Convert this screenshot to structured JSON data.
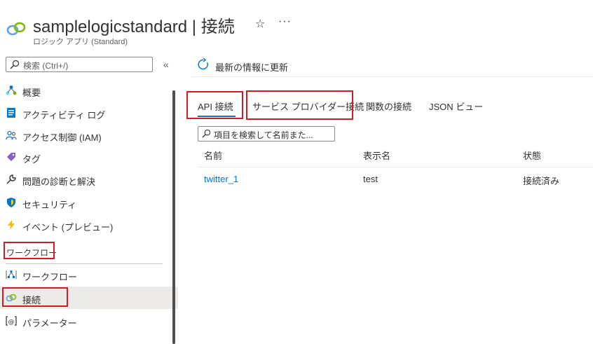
{
  "header": {
    "title": "samplelogicstandard | 接続",
    "subtitle": "ロジック アプリ (Standard)",
    "favorite_icon": "star-icon",
    "more_label": "···"
  },
  "search": {
    "placeholder": "検索 (Ctrl+/)",
    "collapse_label": "«"
  },
  "sidebar": {
    "items": [
      {
        "label": "概要",
        "icon": "overview-icon"
      },
      {
        "label": "アクティビティ ログ",
        "icon": "activity-log-icon"
      },
      {
        "label": "アクセス制御 (IAM)",
        "icon": "access-control-icon"
      },
      {
        "label": "タグ",
        "icon": "tag-icon"
      },
      {
        "label": "問題の診断と解決",
        "icon": "wrench-icon"
      },
      {
        "label": "セキュリティ",
        "icon": "shield-icon"
      },
      {
        "label": "イベント (プレビュー)",
        "icon": "lightning-icon"
      }
    ],
    "section_workflow": "ワークフロー",
    "workflow_items": [
      {
        "label": "ワークフロー",
        "icon": "workflow-icon"
      },
      {
        "label": "接続",
        "icon": "connection-icon",
        "active": true
      },
      {
        "label": "パラメーター",
        "icon": "parameter-icon"
      }
    ]
  },
  "toolbar": {
    "refresh_label": "最新の情報に更新"
  },
  "tabs": [
    {
      "label": "API 接続",
      "selected": true
    },
    {
      "label": "サービス プロバイダー接続",
      "selected": false
    },
    {
      "label": "関数の接続",
      "selected": false
    },
    {
      "label": "JSON ビュー",
      "selected": false
    }
  ],
  "filter": {
    "placeholder": "項目を検索して名前また..."
  },
  "table": {
    "headers": [
      "名前",
      "表示名",
      "状態"
    ],
    "rows": [
      [
        "twitter_1",
        "test",
        "接続済み"
      ]
    ]
  },
  "colors": {
    "accent": "#0078d4",
    "highlight": "#d61a21",
    "active_bg": "#edebe9"
  }
}
